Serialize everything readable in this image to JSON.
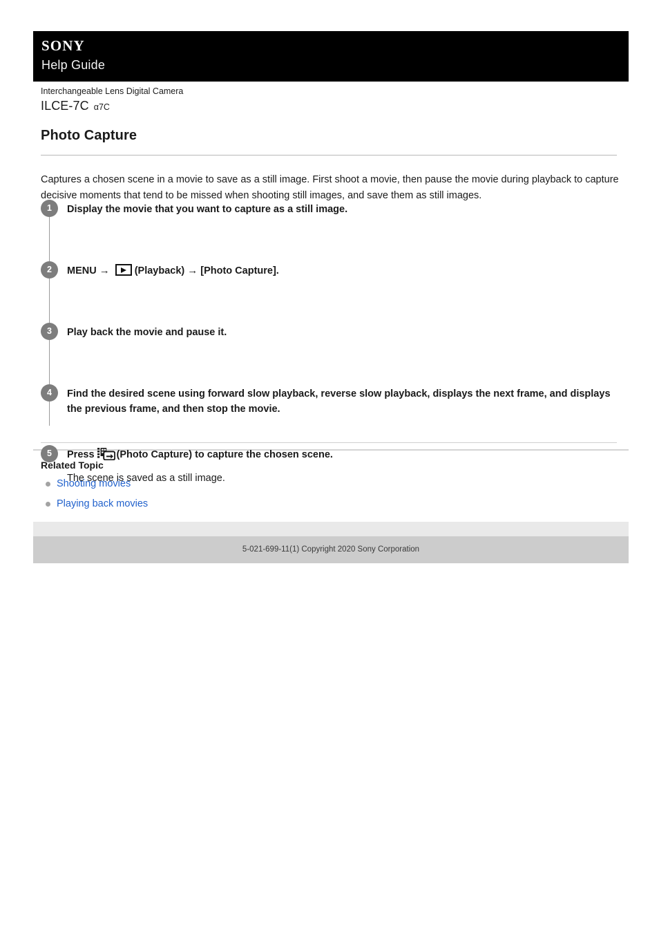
{
  "header": {
    "brand": "SONY",
    "guide_label": "Help Guide"
  },
  "product": {
    "category": "Interchangeable Lens Digital Camera",
    "model": "ILCE-7C",
    "alias": "α7C"
  },
  "article": {
    "title": "Photo Capture",
    "intro": "Captures a chosen scene in a movie to save as a still image. First shoot a movie, then pause the movie during playback to capture decisive moments that tend to be missed when shooting still images, and save them as still images.",
    "steps": [
      {
        "number": "1",
        "title": "Display the movie that you want to capture as a still image."
      },
      {
        "number": "2",
        "title_before": "MENU",
        "arrow_1": "→",
        "icon": "playback-icon",
        "title_middle": "(Playback)",
        "arrow_2": "→",
        "title_after": "[Photo Capture]."
      },
      {
        "number": "3",
        "title": "Play back the movie and pause it."
      },
      {
        "number": "4",
        "title": "Find the desired scene using forward slow playback, reverse slow playback, displays the next frame, and displays the previous frame, and then stop the movie."
      },
      {
        "number": "5",
        "title_before": "Press",
        "icon": "photo-capture-icon",
        "title_after": "(Photo Capture) to capture the chosen scene.",
        "description": "The scene is saved as a still image."
      }
    ]
  },
  "related": {
    "heading": "Related Topic",
    "links": [
      {
        "label": "Shooting movies"
      },
      {
        "label": "Playing back movies"
      }
    ]
  },
  "footer": {
    "copyright": "5-021-699-11(1) Copyright 2020 Sony Corporation"
  },
  "colors": {
    "header_background": "#000000",
    "link": "#2262cc",
    "step_badge": "#7d7d7d",
    "footer_light": "#e9e9e9",
    "footer_dark": "#cccccc"
  }
}
